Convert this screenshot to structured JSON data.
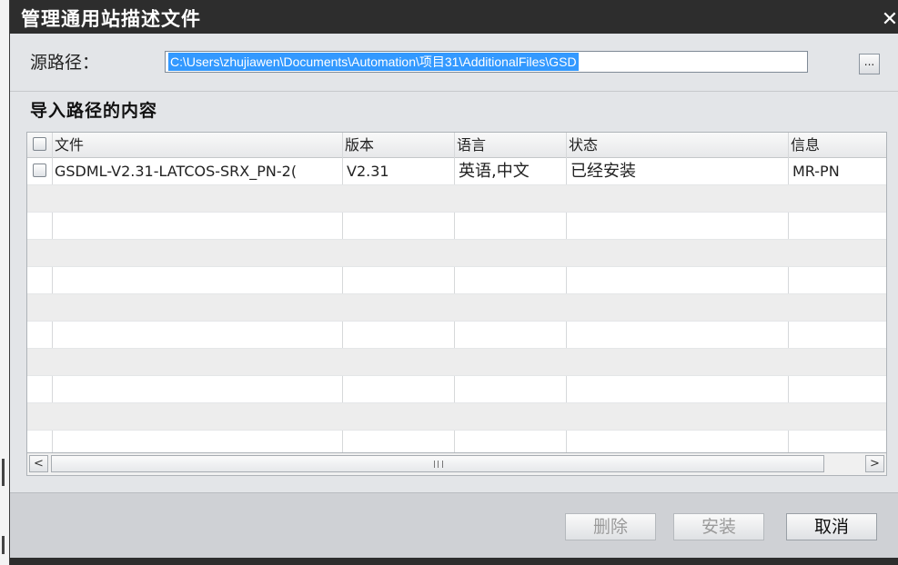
{
  "window": {
    "title": "管理通用站描述文件",
    "close_glyph": "✕"
  },
  "source": {
    "label": "源路径：",
    "path": "C:\\Users\\zhujiawen\\Documents\\Automation\\项目31\\AdditionalFiles\\GSD",
    "browse_label": "..."
  },
  "section": {
    "title": "导入路径的内容"
  },
  "table": {
    "columns": [
      "文件",
      "版本",
      "语言",
      "状态",
      "信息"
    ],
    "rows": [
      {
        "file": "GSDML-V2.31-LATCOS-SRX_PN-2(",
        "version": "V2.31",
        "language": "英语,中文",
        "status": "已经安装",
        "info": "MR-PN"
      }
    ]
  },
  "scrollbar": {
    "left_arrow": "<",
    "right_arrow": ">"
  },
  "buttons": {
    "delete": "删除",
    "install": "安装",
    "cancel": "取消"
  },
  "colors": {
    "titlebar": "#2d2d2d",
    "selection": "#3399ff",
    "dialog_bg": "#e3e5e8"
  }
}
